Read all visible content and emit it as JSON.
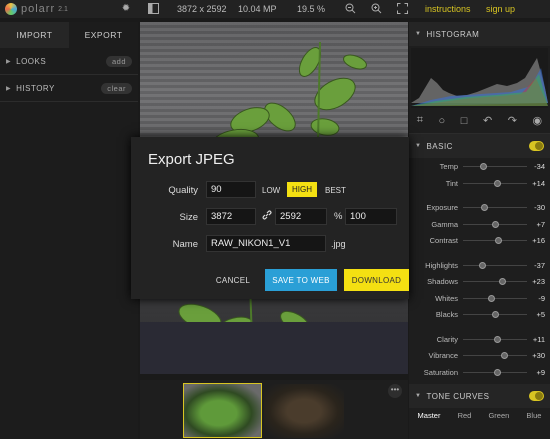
{
  "app": {
    "name": "polarr",
    "version": "2.1"
  },
  "topbar": {
    "resolution": "3872 x 2592",
    "megapixels": "10.04 MP",
    "zoom": "19.5 %",
    "instructions_label": "instructions",
    "signup_label": "sign up"
  },
  "left_panel": {
    "tabs": [
      "IMPORT",
      "EXPORT"
    ],
    "looks": {
      "label": "LOOKS",
      "action": "add"
    },
    "history": {
      "label": "HISTORY",
      "action": "clear"
    }
  },
  "right_panel": {
    "histogram_label": "HISTOGRAM",
    "basic_label": "BASIC",
    "sliders": [
      {
        "label": "Temp",
        "value": "-34",
        "pos": 0.33
      },
      {
        "label": "Tint",
        "value": "+14",
        "pos": 0.55
      },
      {
        "label": "Exposure",
        "value": "-30",
        "pos": 0.35
      },
      {
        "label": "Gamma",
        "value": "+7",
        "pos": 0.52
      },
      {
        "label": "Contrast",
        "value": "+16",
        "pos": 0.56
      },
      {
        "label": "Highlights",
        "value": "-37",
        "pos": 0.31
      },
      {
        "label": "Shadows",
        "value": "+23",
        "pos": 0.62
      },
      {
        "label": "Whites",
        "value": "-9",
        "pos": 0.46
      },
      {
        "label": "Blacks",
        "value": "+5",
        "pos": 0.52
      },
      {
        "label": "Clarity",
        "value": "+11",
        "pos": 0.55
      },
      {
        "label": "Vibrance",
        "value": "+30",
        "pos": 0.65
      },
      {
        "label": "Saturation",
        "value": "+9",
        "pos": 0.54
      }
    ],
    "tone_curves_label": "TONE CURVES",
    "curve_tabs": [
      "Master",
      "Red",
      "Green",
      "Blue"
    ]
  },
  "dialog": {
    "title": "Export JPEG",
    "quality_label": "Quality",
    "quality_value": "90",
    "quality_options": [
      "LOW",
      "HIGH",
      "BEST"
    ],
    "quality_selected": "HIGH",
    "size_label": "Size",
    "width_value": "3872",
    "height_value": "2592",
    "percent_sign": "%",
    "percent_value": "100",
    "name_label": "Name",
    "name_value": "RAW_NIKON1_V1",
    "extension": ".jpg",
    "cancel_label": "CANCEL",
    "save_web_label": "SAVE TO WEB",
    "download_label": "DOWNLOAD"
  },
  "colors": {
    "accent": "#f4e012",
    "web_button": "#2a9fd6",
    "link": "#d8c522"
  }
}
